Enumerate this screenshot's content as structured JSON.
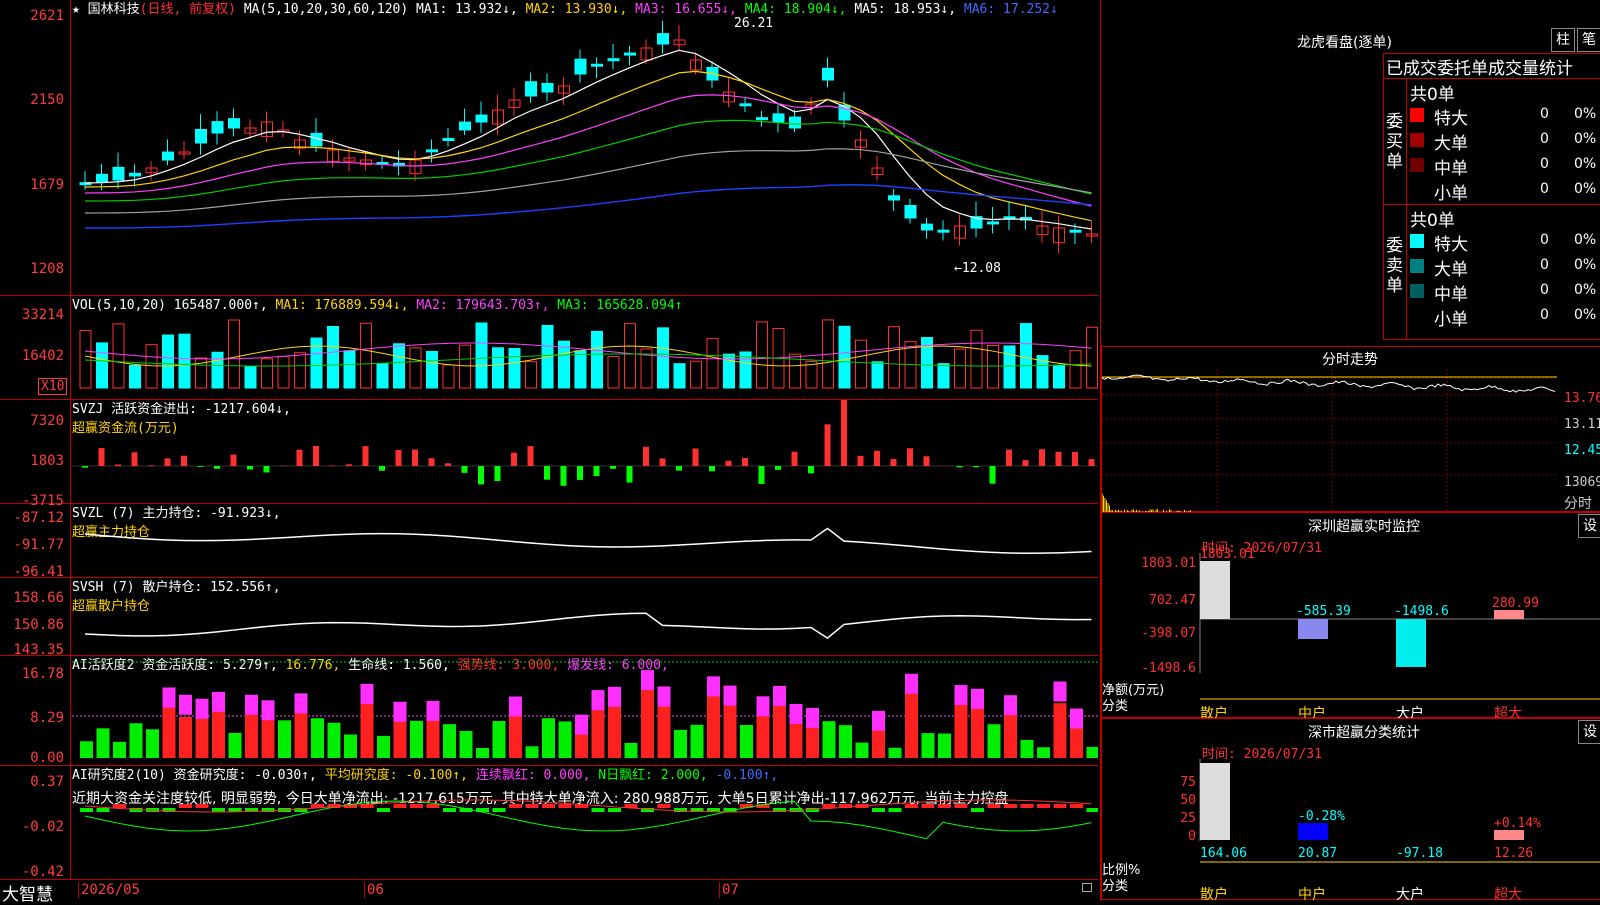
{
  "main_panel": {
    "star": "★",
    "stock_name": "国林科技",
    "mode": "(日线, 前复权)",
    "ma_header": "MA(5,10,20,30,60,120)",
    "ma1": "MA1: 13.932↓,",
    "ma2": "MA2: 13.930↓,",
    "ma3": "MA3: 16.655↓,",
    "ma4": "MA4: 18.904↓,",
    "ma5": "MA5: 18.953↓,",
    "ma6": "MA6: 17.252↓",
    "y_ticks": [
      "2621",
      "2150",
      "1679",
      "1208"
    ],
    "high_label": "26.21",
    "low_label": "←12.08"
  },
  "vol_panel": {
    "header": "VOL(5,10,20)",
    "value": "165487.000↑,",
    "ma1": "MA1: 176889.594↓,",
    "ma2": "MA2: 179643.703↑,",
    "ma3": "MA3: 165628.094↑",
    "y_ticks": [
      "33214",
      "16402"
    ],
    "unit": "X10"
  },
  "svzj_panel": {
    "header": "SVZJ  活跃资金进出: -1217.604↓,",
    "sub": "超赢资金流(万元)",
    "y_ticks": [
      "7320",
      "1803",
      "-3715"
    ]
  },
  "svzl_panel": {
    "header": "SVZL (7) 主力持仓: -91.923↓,",
    "sub": "超赢主力持仓",
    "y_ticks": [
      "-87.12",
      "-91.77",
      "-96.41"
    ]
  },
  "svsh_panel": {
    "header": "SVSH (7) 散户持仓: 152.556↑,",
    "sub": "超赢散户持仓",
    "y_ticks": [
      "158.66",
      "150.86",
      "143.35"
    ]
  },
  "ai_active_panel": {
    "header_a": "AI活跃度2 资金活跃度: 5.279↑,",
    "header_b": "16.776,",
    "header_c": "生命线: 1.560,",
    "header_d": "强势线: 3.000,",
    "header_e": "爆发线: 6.000,",
    "y_ticks": [
      "16.78",
      "8.29",
      "0.00"
    ]
  },
  "ai_research_panel": {
    "header_a": "AI研究度2(10) 资金研究度: -0.030↑,",
    "header_b": "平均研究度: -0.100↑,",
    "header_c": "连续飘红: 0.000,",
    "header_d": "N日飘红: 2.000,",
    "header_e": "-0.100↑,",
    "comment": "近期大资金关注度较低, 明显弱势, 今日大单净流出: -1217.615万元, 其中特大单净流入: 280.988万元, 大单5日累计净出-117.962万元, 当前主力控盘",
    "y_ticks": [
      "0.37",
      "-0.02",
      "-0.42"
    ]
  },
  "bottom_bar": {
    "brand": "大智慧",
    "dates": [
      "2026/05",
      "06",
      "07"
    ]
  },
  "longhu": {
    "title": "龙虎看盘(逐单)",
    "btn_bar": "柱",
    "btn_pen": "笔",
    "tab_header": "已成交委托单成交量统计",
    "buy_label": "委买单",
    "sell_label": "委卖单",
    "buy_total": "共0单",
    "sell_total": "共0单",
    "rows": [
      "特大",
      "大单",
      "中单",
      "小单"
    ],
    "count": "0",
    "pct": "0%"
  },
  "fenshi": {
    "title": "分时走势",
    "prices": [
      "13.76",
      "13.11",
      "12.45"
    ],
    "vol": "13069",
    "unit": "分时"
  },
  "sz_monitor": {
    "title": "深圳超赢实时监控",
    "settings": "设",
    "time": "时间: 2026/07/31",
    "y_ticks": [
      "1803.01",
      "702.47",
      "-398.07",
      "-1498.6"
    ],
    "axis_label_1": "净额(万元)",
    "axis_label_2": "分类",
    "categories": [
      "散户",
      "中户",
      "大户",
      "超大"
    ],
    "values": [
      "1803.01",
      "-585.39",
      "-1498.6",
      "280.99"
    ]
  },
  "sz_class": {
    "title": "深市超赢分类统计",
    "settings": "设",
    "time": "时间: 2026/07/31",
    "y_ticks": [
      "75",
      "50",
      "25",
      "0"
    ],
    "axis_label_1": "比例%",
    "axis_label_2": "分类",
    "categories": [
      "散户",
      "中户",
      "大户",
      "超大"
    ],
    "values": [
      "164.06",
      "20.87",
      "-97.18",
      "12.26"
    ],
    "labels": [
      "-0.28%",
      "+0.14%"
    ]
  },
  "colors": {
    "up": "#ff3030",
    "down": "#00ffff",
    "border": "#c00000",
    "ma_white": "#ffffff",
    "ma_yellow": "#ffd400",
    "ma_magenta": "#ff40ff",
    "ma_green": "#00cc00",
    "ma_grey": "#a0a0a0",
    "ma_blue": "#2040ff"
  }
}
